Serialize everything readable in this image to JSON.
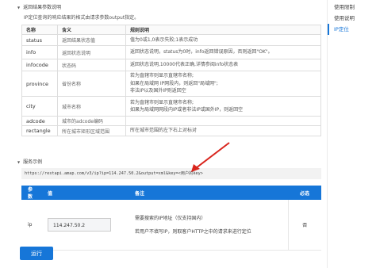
{
  "result_section": {
    "title": "返回结果参数说明",
    "intro": "IP定位查询的响应结果的格式由请求参数output指定。",
    "headers": [
      "名称",
      "含义",
      "规则说明"
    ],
    "rows": [
      {
        "name": "status",
        "meaning": "返回结果状态值",
        "rules": [
          "值为0或1,0表示失败;1表示成功"
        ]
      },
      {
        "name": "info",
        "meaning": "返回状态说明",
        "rules": [
          "返回状态说明，status为0时，info返回错误原因，否则返回\"OK\"。"
        ]
      },
      {
        "name": "infocode",
        "meaning": "状态码",
        "rules": [
          "返回状态说明,10000代表正确,详情参阅info状态表"
        ]
      },
      {
        "name": "province",
        "meaning": "省份名称",
        "rules": [
          "若为直辖市则显示直辖市名称;",
          "如果在局域网 IP网段内，则返回\"局域网\";",
          "非法IP以及国外IP则返回空"
        ]
      },
      {
        "name": "city",
        "meaning": "城市名称",
        "rules": [
          "若为直辖市则显示直辖市名称;",
          "如果为局域网网段内IP或者非法IP或国外IP，则返回空"
        ]
      },
      {
        "name": "adcode",
        "meaning": "城市的adcode编码",
        "rules": [
          ""
        ]
      },
      {
        "name": "rectangle",
        "meaning": "所在城市矩形区域范围",
        "rules": [
          "所在城市范围的左下右上对标对"
        ]
      }
    ]
  },
  "example_section": {
    "title": "服务示例",
    "url": "https://restapi.amap.com/v3/ip?ip=114.247.50.2&output=xml&key=<用户的key>",
    "headers": {
      "param": "参数",
      "value": "值",
      "note": "备注",
      "required": "必选"
    },
    "row": {
      "param": "ip",
      "value": "114.247.50.2",
      "note_lines": [
        "需要搜索的IP地址（仅支持国内）",
        "若用户不填写IP，则取客户HTTP之中的请求来进行定位"
      ],
      "required": "否"
    },
    "run_label": "运行"
  },
  "sidebar": {
    "items": [
      {
        "label": "使用限制",
        "active": false
      },
      {
        "label": "使用说明",
        "active": false
      },
      {
        "label": "IP定位",
        "active": true
      }
    ]
  },
  "colors": {
    "accent": "#1676d8",
    "arrow": "#d9251d"
  }
}
